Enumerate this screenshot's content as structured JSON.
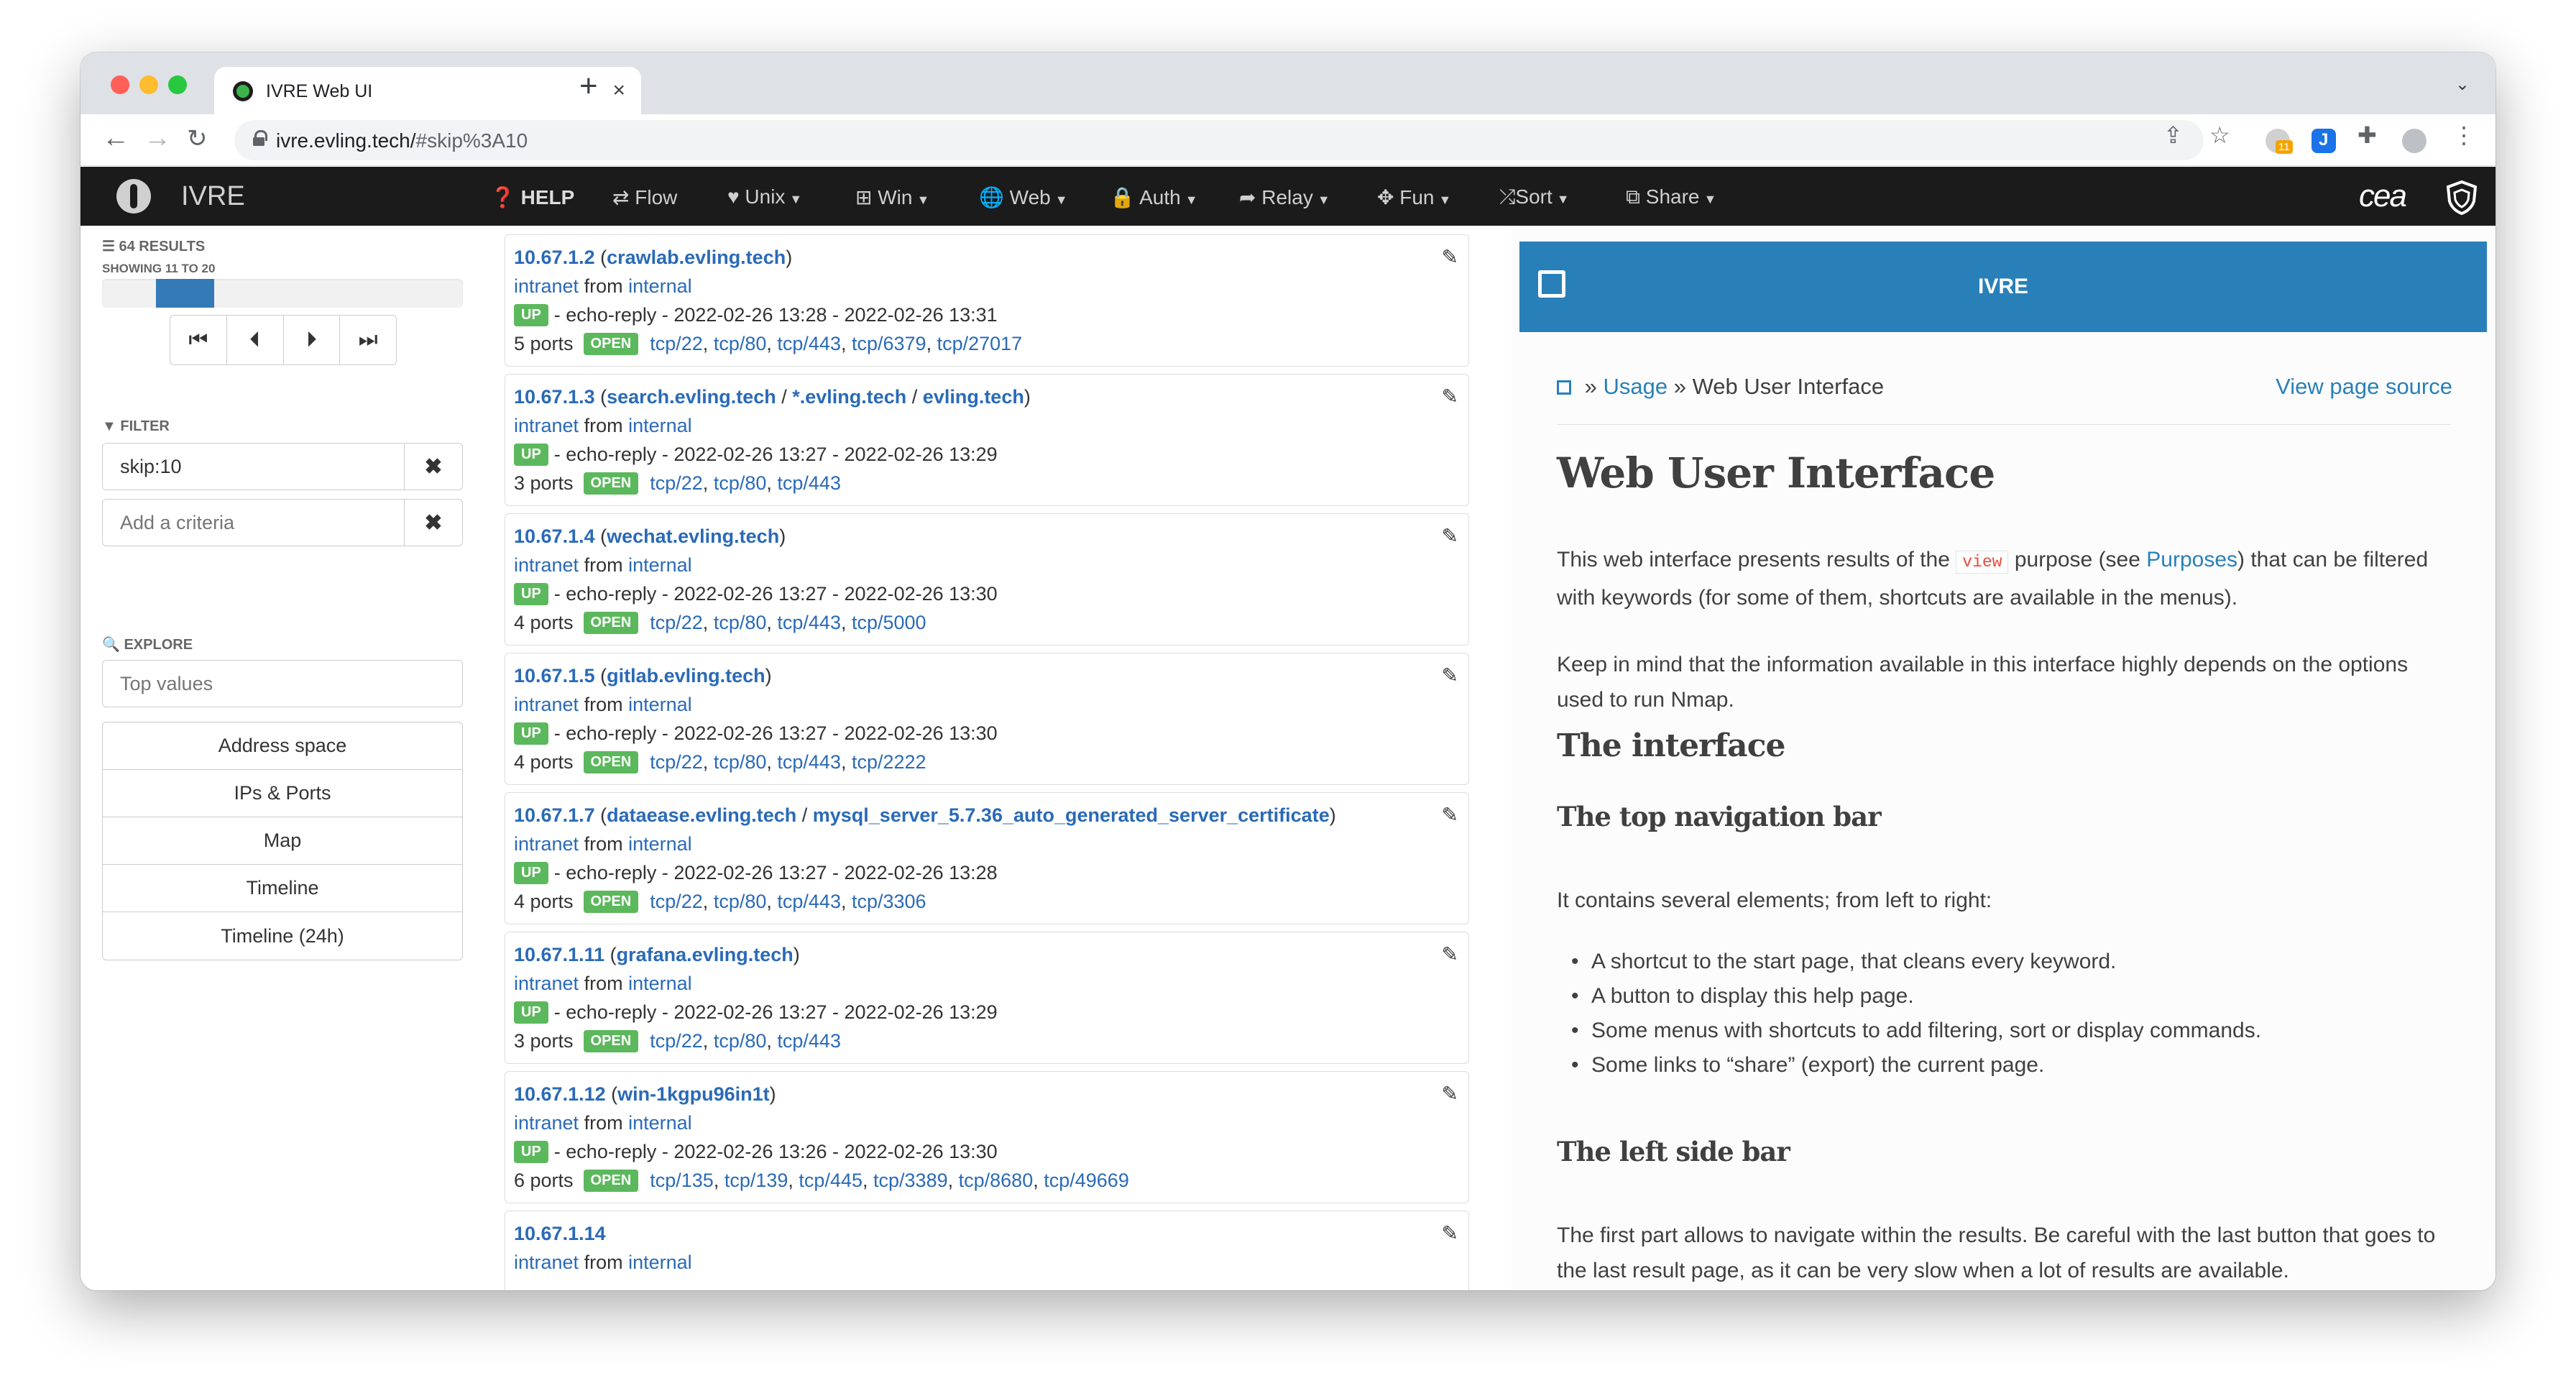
{
  "browser": {
    "tab_title": "IVRE Web UI",
    "tab_close": "×",
    "new_tab": "+",
    "url_host": "ivre.evling.tech/",
    "url_path": "#skip%3A10",
    "ext_badge": "11"
  },
  "navbar": {
    "brand": "IVRE",
    "items": [
      {
        "label": "HELP"
      },
      {
        "label": "Flow"
      },
      {
        "label": "Unix"
      },
      {
        "label": "Win"
      },
      {
        "label": "Web"
      },
      {
        "label": "Auth"
      },
      {
        "label": "Relay"
      },
      {
        "label": "Fun"
      },
      {
        "label": "Sort"
      },
      {
        "label": "Share"
      }
    ],
    "partner_logo": "cea"
  },
  "sidebar": {
    "results_label": "64 RESULTS",
    "showing_label": "SHOWING 11 TO 20",
    "progress": {
      "start": 0.15,
      "end": 0.31
    },
    "filter_label": "FILTER",
    "filters": [
      {
        "value": "skip:10",
        "placeholder": ""
      },
      {
        "value": "",
        "placeholder": "Add a criteria"
      }
    ],
    "explore_label": "EXPLORE",
    "topvalues_placeholder": "Top values",
    "explore_items": [
      "Address space",
      "IPs & Ports",
      "Map",
      "Timeline",
      "Timeline (24h)"
    ]
  },
  "results": [
    {
      "ip": "10.67.1.2",
      "hostnames": [
        "crawlab.evling.tech"
      ],
      "category": "intranet",
      "from": "from",
      "source": "internal",
      "status": "UP",
      "reason": "- echo-reply - 2022-02-26 13:28 - 2022-02-26 13:31",
      "ports_count": "5 ports",
      "open": "OPEN",
      "ports": [
        "tcp/22",
        "tcp/80",
        "tcp/443",
        "tcp/6379",
        "tcp/27017"
      ]
    },
    {
      "ip": "10.67.1.3",
      "hostnames": [
        "search.evling.tech",
        "*.evling.tech",
        "evling.tech"
      ],
      "category": "intranet",
      "from": "from",
      "source": "internal",
      "status": "UP",
      "reason": "- echo-reply - 2022-02-26 13:27 - 2022-02-26 13:29",
      "ports_count": "3 ports",
      "open": "OPEN",
      "ports": [
        "tcp/22",
        "tcp/80",
        "tcp/443"
      ]
    },
    {
      "ip": "10.67.1.4",
      "hostnames": [
        "wechat.evling.tech"
      ],
      "category": "intranet",
      "from": "from",
      "source": "internal",
      "status": "UP",
      "reason": "- echo-reply - 2022-02-26 13:27 - 2022-02-26 13:30",
      "ports_count": "4 ports",
      "open": "OPEN",
      "ports": [
        "tcp/22",
        "tcp/80",
        "tcp/443",
        "tcp/5000"
      ]
    },
    {
      "ip": "10.67.1.5",
      "hostnames": [
        "gitlab.evling.tech"
      ],
      "category": "intranet",
      "from": "from",
      "source": "internal",
      "status": "UP",
      "reason": "- echo-reply - 2022-02-26 13:27 - 2022-02-26 13:30",
      "ports_count": "4 ports",
      "open": "OPEN",
      "ports": [
        "tcp/22",
        "tcp/80",
        "tcp/443",
        "tcp/2222"
      ]
    },
    {
      "ip": "10.67.1.7",
      "hostnames": [
        "dataease.evling.tech",
        "mysql_server_5.7.36_auto_generated_server_certificate"
      ],
      "category": "intranet",
      "from": "from",
      "source": "internal",
      "status": "UP",
      "reason": "- echo-reply - 2022-02-26 13:27 - 2022-02-26 13:28",
      "ports_count": "4 ports",
      "open": "OPEN",
      "ports": [
        "tcp/22",
        "tcp/80",
        "tcp/443",
        "tcp/3306"
      ]
    },
    {
      "ip": "10.67.1.11",
      "hostnames": [
        "grafana.evling.tech"
      ],
      "category": "intranet",
      "from": "from",
      "source": "internal",
      "status": "UP",
      "reason": "- echo-reply - 2022-02-26 13:27 - 2022-02-26 13:29",
      "ports_count": "3 ports",
      "open": "OPEN",
      "ports": [
        "tcp/22",
        "tcp/80",
        "tcp/443"
      ]
    },
    {
      "ip": "10.67.1.12",
      "hostnames": [
        "win-1kgpu96in1t"
      ],
      "category": "intranet",
      "from": "from",
      "source": "internal",
      "status": "UP",
      "reason": "- echo-reply - 2022-02-26 13:26 - 2022-02-26 13:30",
      "ports_count": "6 ports",
      "open": "OPEN",
      "ports": [
        "tcp/135",
        "tcp/139",
        "tcp/445",
        "tcp/3389",
        "tcp/8680",
        "tcp/49669"
      ]
    },
    {
      "ip": "10.67.1.14",
      "hostnames": [],
      "category": "intranet",
      "from": "from",
      "source": "internal",
      "status": "",
      "reason": "",
      "ports_count": "",
      "open": "",
      "ports": []
    }
  ],
  "docs": {
    "header_title": "IVRE",
    "breadcrumb_sep": "»",
    "breadcrumb_link": "Usage",
    "breadcrumb_current": "Web User Interface",
    "view_source": "View page source",
    "h1": "Web User Interface",
    "p1_before": "This web interface presents results of the ",
    "p1_code": "view",
    "p1_mid": " purpose (see ",
    "p1_link": "Purposes",
    "p1_after": ") that can be filtered with keywords (for some of them, shortcuts are available in the menus).",
    "p2": "Keep in mind that the information available in this interface highly depends on the options used to run Nmap.",
    "h2_interface": "The interface",
    "h3_top": "The top navigation bar",
    "p3": "It contains several elements; from left to right:",
    "list": [
      "A shortcut to the start page, that cleans every keyword.",
      "A button to display this help page.",
      "Some menus with shortcuts to add filtering, sort or display commands.",
      "Some links to “share” (export) the current page."
    ],
    "h3_left": "The left side bar",
    "p4": "The first part allows to navigate within the results. Be careful with the last button that goes to the last result page, as it can be very slow when a lot of results are available."
  }
}
